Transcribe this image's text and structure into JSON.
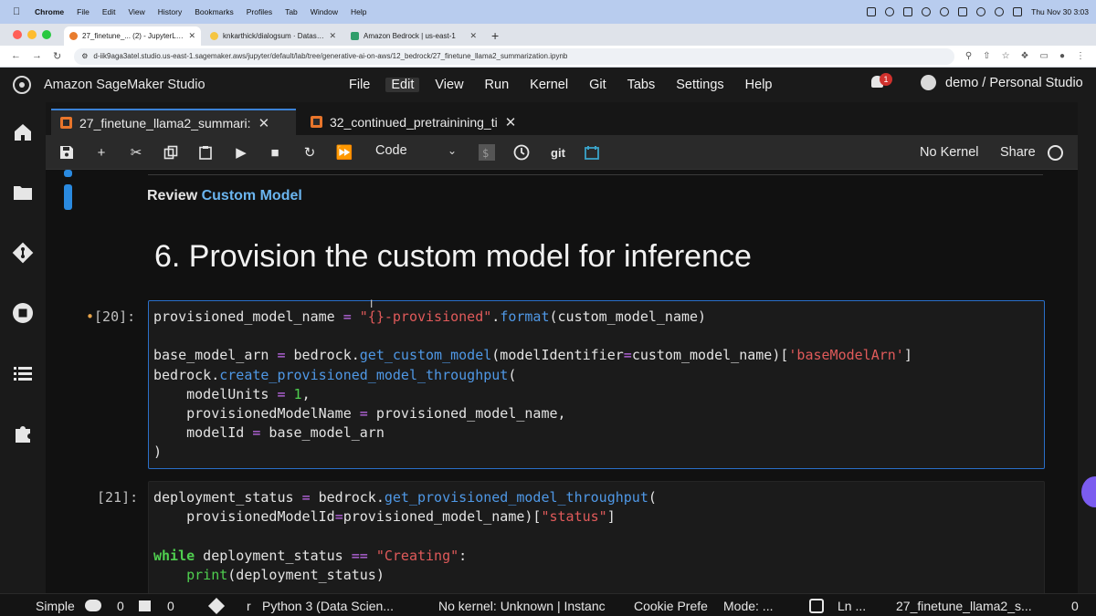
{
  "mac_menubar": {
    "app": "Chrome",
    "items": [
      "File",
      "Edit",
      "View",
      "History",
      "Bookmarks",
      "Profiles",
      "Tab",
      "Window",
      "Help"
    ],
    "clock": "Thu Nov 30  3:03"
  },
  "browser": {
    "tabs": [
      {
        "title": "27_finetune_... (2) - JupyterLab"
      },
      {
        "title": "knkarthick/dialogsum · Datasets"
      },
      {
        "title": "Amazon Bedrock | us-east-1"
      }
    ],
    "url": "d-iik9aga3atel.studio.us-east-1.sagemaker.aws/jupyter/default/lab/tree/generative-ai-on-aws/12_bedrock/27_finetune_llama2_summarization.ipynb"
  },
  "studio": {
    "brand": "Amazon SageMaker Studio",
    "menus": [
      "File",
      "Edit",
      "View",
      "Run",
      "Kernel",
      "Git",
      "Tabs",
      "Settings",
      "Help"
    ],
    "notifications": "1",
    "user": "demo / Personal Studio"
  },
  "notebook_tabs": [
    {
      "label": "27_finetune_llama2_summari:"
    },
    {
      "label": "32_continued_pretrainining_ti"
    }
  ],
  "toolbar": {
    "cell_type": "Code",
    "git": "git",
    "kernel_status": "No Kernel",
    "share": "Share"
  },
  "notebook": {
    "review_prefix": "Review",
    "review_link": "Custom Model",
    "heading": "6. Provision the custom model for inference",
    "cell20_prompt": "[20]:",
    "cell21_prompt": "[21]:"
  },
  "statusbar": {
    "mode": "Simple",
    "terminals": "0",
    "kernels": "0",
    "branch": "r",
    "kernel_name": "Python 3 (Data Scien...",
    "kernel_info": "No kernel: Unknown | Instanc",
    "cookie": "Cookie Prefe",
    "edit_mode": "Mode: ...",
    "line": "Ln ...",
    "file": "27_finetune_llama2_s...",
    "count": "0"
  }
}
